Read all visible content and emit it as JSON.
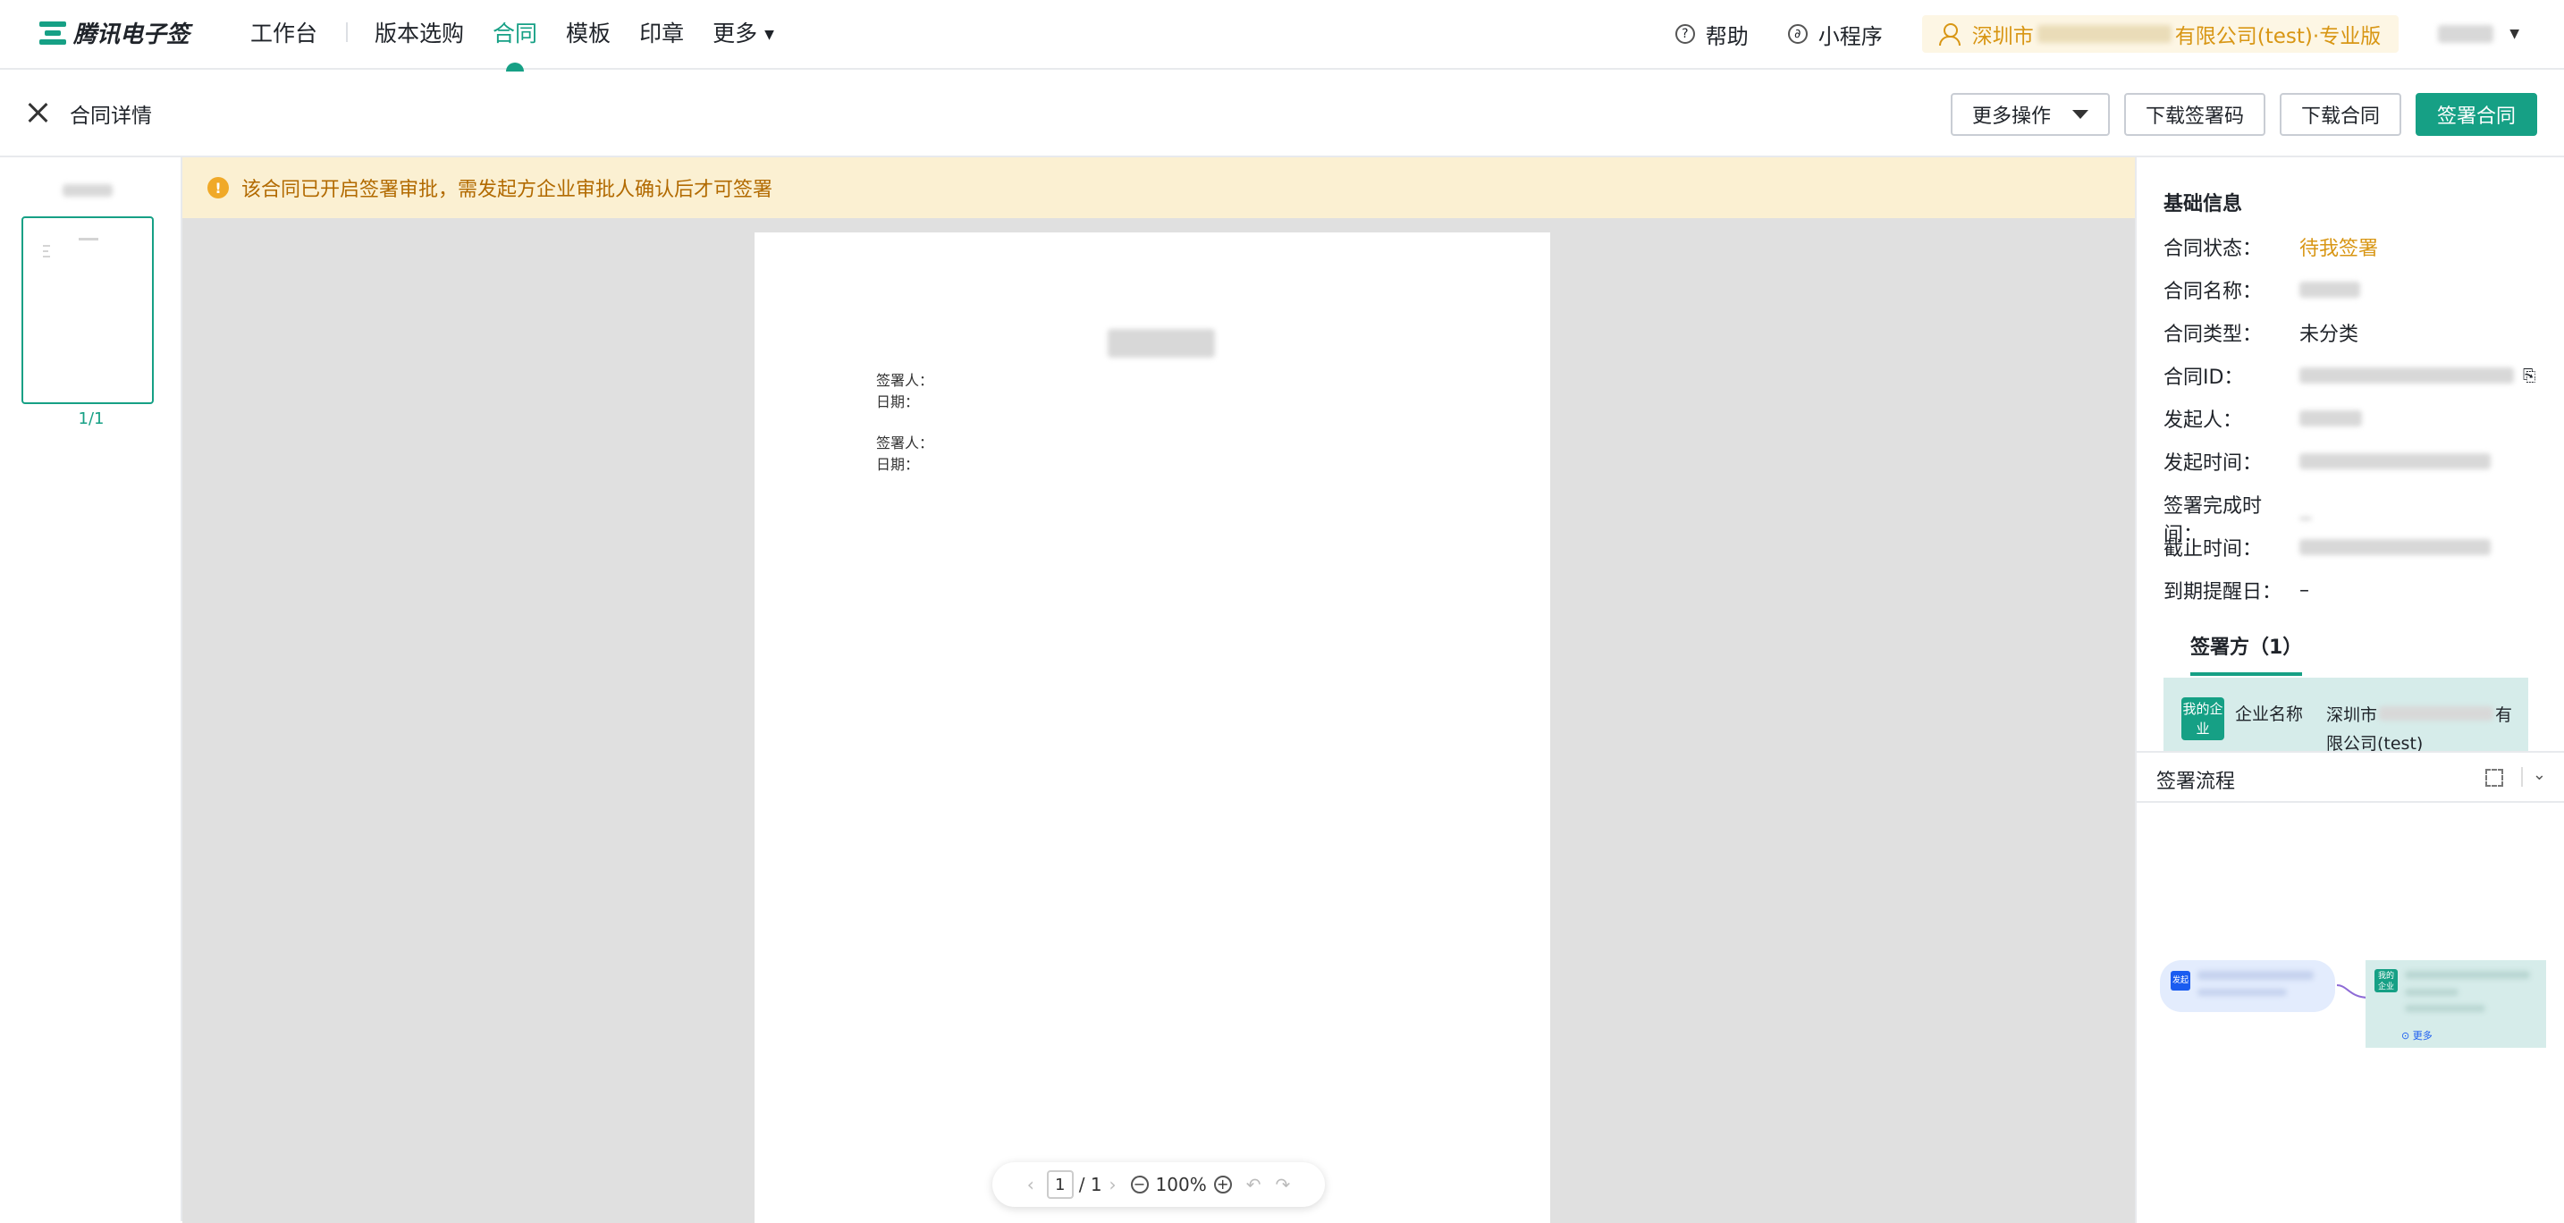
{
  "nav": {
    "logo": "腾讯电子签",
    "items": [
      "工作台",
      "版本选购",
      "合同",
      "模板",
      "印章",
      "更多"
    ],
    "active": "合同",
    "help": "帮助",
    "miniprogram": "小程序",
    "org_prefix": "深圳市",
    "org_suffix": "有限公司(test)·专业版",
    "colors": {
      "accent": "#16a085",
      "org": "#d89614"
    }
  },
  "subbar": {
    "title": "合同详情",
    "more_ops": "更多操作",
    "download_code": "下载签署码",
    "download_contract": "下载合同",
    "sign_contract": "签署合同"
  },
  "thumb": {
    "page": "1/1"
  },
  "viewer": {
    "notice": "该合同已开启签署审批，需发起方企业审批人确认后才可签署",
    "doc_lines": [
      "签署人：",
      "日期：",
      "签署人：",
      "日期："
    ],
    "pager": {
      "current": "1",
      "total": "/ 1",
      "zoom": "100%"
    }
  },
  "panel": {
    "section_title": "基础信息",
    "rows": [
      {
        "label": "合同状态：",
        "value": "待我签署"
      },
      {
        "label": "合同名称：",
        "value": ""
      },
      {
        "label": "合同类型：",
        "value": "未分类"
      },
      {
        "label": "合同ID：",
        "value": ""
      },
      {
        "label": "发起人：",
        "value": ""
      },
      {
        "label": "发起时间：",
        "value": ""
      },
      {
        "label": "签署完成时间：",
        "value": ""
      },
      {
        "label": "截止时间：",
        "value": ""
      },
      {
        "label": "到期提醒日：",
        "value": "–"
      }
    ],
    "signers_tab": "签署方（1）",
    "signer": {
      "badge": "我的企业",
      "label": "企业名称",
      "name_prefix": "深圳市",
      "name_suffix": "有",
      "name_line2": "限公司(test)"
    },
    "flow_title": "签署流程",
    "flow": {
      "initiator_badge": "发起",
      "signer_badge": "我的企业",
      "more": "更多"
    }
  }
}
